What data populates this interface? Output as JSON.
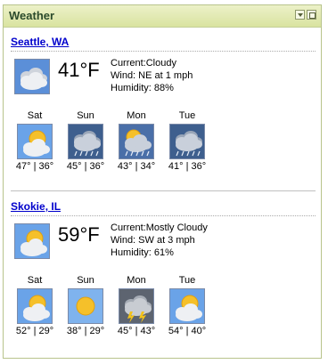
{
  "header": {
    "title": "Weather"
  },
  "locations": [
    {
      "city": "Seattle, WA",
      "current": {
        "temp": "41°F",
        "condition": "Current:Cloudy",
        "wind": "Wind: NE at 1 mph",
        "humidity": "Humidity: 88%",
        "icon": "cloudy-icon"
      },
      "forecast": [
        {
          "day": "Sat",
          "range": "47° | 36°",
          "icon": "partly-cloudy-icon"
        },
        {
          "day": "Sun",
          "range": "45° | 36°",
          "icon": "rain-icon"
        },
        {
          "day": "Mon",
          "range": "43° | 34°",
          "icon": "chance-of-rain-icon"
        },
        {
          "day": "Tue",
          "range": "41° | 36°",
          "icon": "rain-icon"
        }
      ]
    },
    {
      "city": "Skokie, IL",
      "current": {
        "temp": "59°F",
        "condition": "Current:Mostly Cloudy",
        "wind": "Wind: SW at 3 mph",
        "humidity": "Humidity: 61%",
        "icon": "mostly-cloudy-icon"
      },
      "forecast": [
        {
          "day": "Sat",
          "range": "52° | 29°",
          "icon": "partly-cloudy-icon"
        },
        {
          "day": "Sun",
          "range": "38° | 29°",
          "icon": "sunny-icon"
        },
        {
          "day": "Mon",
          "range": "45° | 43°",
          "icon": "thunderstorm-icon"
        },
        {
          "day": "Tue",
          "range": "54° | 40°",
          "icon": "partly-cloudy-icon"
        }
      ]
    }
  ]
}
